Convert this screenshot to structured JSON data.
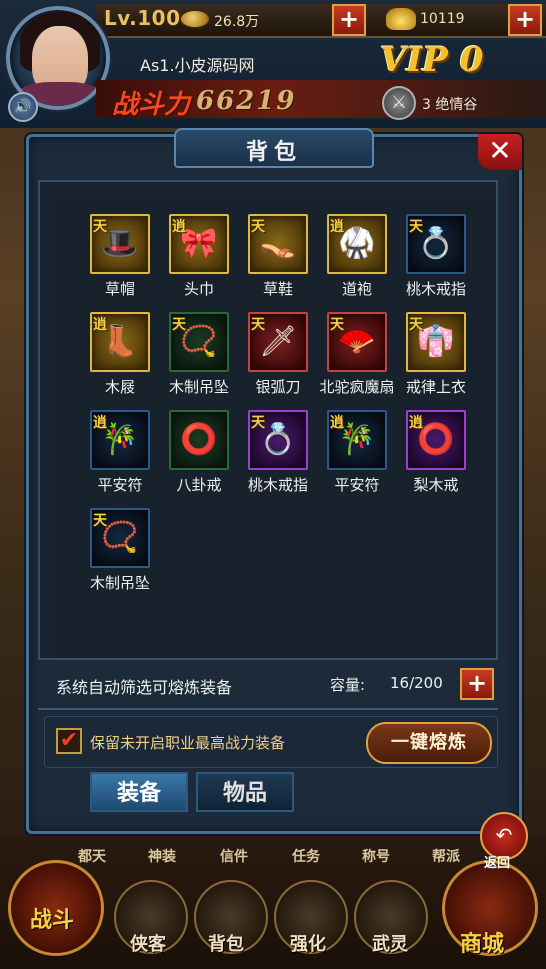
{
  "hud": {
    "level": "Lv.100",
    "coins": "26.8万",
    "gold": "10119",
    "player_name": "As1.小皮源码网",
    "vip": "VIP 0",
    "power_label": "战斗力",
    "power_value": "66219",
    "guild": "3 绝情谷",
    "plus": "+"
  },
  "panel": {
    "title": "背包",
    "close": "✕"
  },
  "items": [
    {
      "grade": "天",
      "name": "草帽",
      "rarity": "gold",
      "glyph": "🎩"
    },
    {
      "grade": "逍",
      "name": "头巾",
      "rarity": "gold",
      "glyph": "🎀"
    },
    {
      "grade": "天",
      "name": "草鞋",
      "rarity": "gold",
      "glyph": "👡"
    },
    {
      "grade": "逍",
      "name": "道袍",
      "rarity": "gold",
      "glyph": "🥋"
    },
    {
      "grade": "天",
      "name": "桃木戒指",
      "rarity": "blue",
      "glyph": "💍"
    },
    {
      "grade": "逍",
      "name": "木屐",
      "rarity": "gold",
      "glyph": "👢"
    },
    {
      "grade": "天",
      "name": "木制吊坠",
      "rarity": "green",
      "glyph": "📿"
    },
    {
      "grade": "天",
      "name": "银弧刀",
      "rarity": "red",
      "glyph": "🗡"
    },
    {
      "grade": "天",
      "name": "北驼疯魔扇",
      "rarity": "red",
      "glyph": "🪭"
    },
    {
      "grade": "天",
      "name": "戒律上衣",
      "rarity": "gold",
      "glyph": "👘"
    },
    {
      "grade": "逍",
      "name": "平安符",
      "rarity": "blue",
      "glyph": "🎋"
    },
    {
      "grade": "",
      "name": "八卦戒",
      "rarity": "green",
      "glyph": "⭕"
    },
    {
      "grade": "天",
      "name": "桃木戒指",
      "rarity": "purple",
      "glyph": "💍"
    },
    {
      "grade": "逍",
      "name": "平安符",
      "rarity": "blue",
      "glyph": "🎋"
    },
    {
      "grade": "逍",
      "name": "梨木戒",
      "rarity": "purple",
      "glyph": "⭕"
    },
    {
      "grade": "天",
      "name": "木制吊坠",
      "rarity": "blue",
      "glyph": "📿"
    }
  ],
  "footer": {
    "auto_filter": "系统自动筛选可熔炼装备",
    "capacity_label": "容量:",
    "capacity_value": "16/200",
    "keep_checked": "✔",
    "keep_text": "保留未开启职业最高战力装备",
    "smelt_button": "一键熔炼"
  },
  "tabs": [
    {
      "label": "装备",
      "active": true
    },
    {
      "label": "物品",
      "active": false
    }
  ],
  "subnav": [
    "都天",
    "神装",
    "信件",
    "任务",
    "称号",
    "帮派"
  ],
  "nav": [
    {
      "label": "战斗",
      "big": true
    },
    {
      "label": "侠客"
    },
    {
      "label": "背包"
    },
    {
      "label": "强化"
    },
    {
      "label": "武灵"
    },
    {
      "label": "商城",
      "big": true
    }
  ],
  "return": {
    "label": "返回",
    "icon": "↶"
  }
}
